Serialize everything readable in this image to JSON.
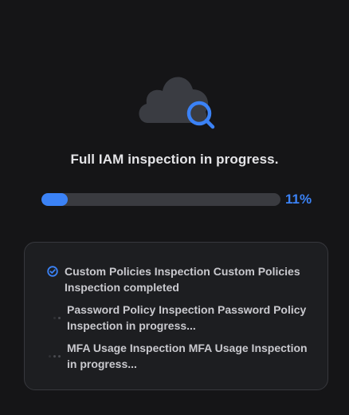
{
  "status": {
    "title": "Full IAM inspection in progress.",
    "progress": 0.11,
    "progress_label": "11%"
  },
  "colors": {
    "accent": "#3b82f6",
    "background": "#151517",
    "panel": "#1d1e21",
    "cloud": "#3a3c42"
  },
  "icons": {
    "hero": "cloud-search-icon",
    "completed": "check-circle-icon",
    "pending": "loading-dots-icon"
  },
  "steps": [
    {
      "state": "completed",
      "text": "Custom Policies Inspection Custom Policies Inspection completed"
    },
    {
      "state": "in-progress",
      "text": "Password Policy Inspection Password Policy Inspection in progress..."
    },
    {
      "state": "in-progress",
      "text": "MFA Usage Inspection MFA Usage Inspection in progress..."
    }
  ]
}
